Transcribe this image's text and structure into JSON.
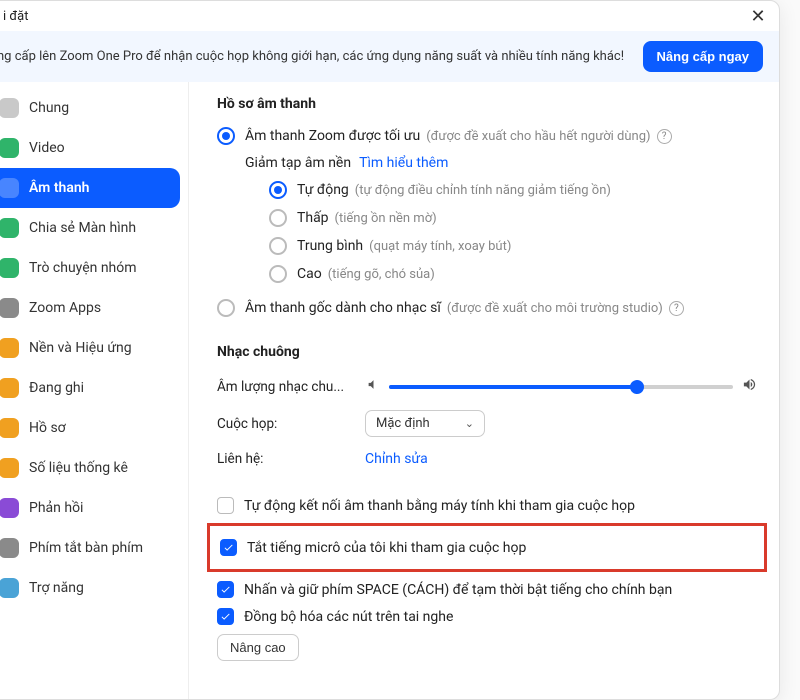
{
  "window": {
    "title": "i đặt",
    "close_glyph": "✕"
  },
  "banner": {
    "text": "ng cấp lên Zoom One Pro để nhận cuộc họp không giới hạn, các ứng dụng năng suất và nhiều tính năng khác!",
    "button": "Nâng cấp ngay"
  },
  "sidebar": {
    "items": [
      {
        "label": "Chung",
        "color": "#c9c9c9",
        "active": false
      },
      {
        "label": "Video",
        "color": "#2fb46a",
        "active": false
      },
      {
        "label": "Âm thanh",
        "color": "#0b5cff",
        "active": true
      },
      {
        "label": "Chia sẻ Màn hình",
        "color": "#2fb46a",
        "active": false
      },
      {
        "label": "Trò chuyện nhóm",
        "color": "#2fb46a",
        "active": false
      },
      {
        "label": "Zoom Apps",
        "color": "#8a8a8a",
        "active": false
      },
      {
        "label": "Nền và Hiệu ứng",
        "color": "#f0a020",
        "active": false
      },
      {
        "label": "Đang ghi",
        "color": "#f0a020",
        "active": false
      },
      {
        "label": "Hồ sơ",
        "color": "#f0a020",
        "active": false
      },
      {
        "label": "Số liệu thống kê",
        "color": "#f0a020",
        "active": false
      },
      {
        "label": "Phản hồi",
        "color": "#8a4bd6",
        "active": false
      },
      {
        "label": "Phím tắt bàn phím",
        "color": "#8a8a8a",
        "active": false
      },
      {
        "label": "Trợ năng",
        "color": "#4aa3d6",
        "active": false
      }
    ]
  },
  "profile": {
    "section_title": "Hồ sơ âm thanh",
    "opt_zoom_label": "Âm thanh Zoom được tối ưu",
    "opt_zoom_hint": "(được đề xuất cho hầu hết người dùng)",
    "noise_label": "Giảm tạp âm nền",
    "noise_link": "Tìm hiểu thêm",
    "noise_opts": [
      {
        "label": "Tự động",
        "hint": "(tự động điều chỉnh tính năng giảm tiếng ồn)",
        "checked": true
      },
      {
        "label": "Thấp",
        "hint": "(tiếng ồn nền mờ)",
        "checked": false
      },
      {
        "label": "Trung bình",
        "hint": "(quạt máy tính, xoay bút)",
        "checked": false
      },
      {
        "label": "Cao",
        "hint": "(tiếng gõ, chó sủa)",
        "checked": false
      }
    ],
    "opt_original_label": "Âm thanh gốc dành cho nhạc sĩ",
    "opt_original_hint": "(được đề xuất cho môi trường studio)"
  },
  "ringtone": {
    "section_title": "Nhạc chuông",
    "volume_label": "Âm lượng nhạc chu...",
    "slider_percent": 72,
    "meeting_label": "Cuộc họp:",
    "meeting_value": "Mặc định",
    "contact_label": "Liên hệ:",
    "contact_value": "Chỉnh sửa"
  },
  "checks": {
    "items": [
      {
        "label": "Tự động kết nối âm thanh bằng máy tính khi tham gia cuộc họp",
        "checked": false,
        "highlight": false
      },
      {
        "label": "Tắt tiếng micrô của tôi khi tham gia cuộc họp",
        "checked": true,
        "highlight": true
      },
      {
        "label": "Nhấn và giữ phím SPACE (CÁCH) để tạm thời bật tiếng cho chính bạn",
        "checked": true,
        "highlight": false
      },
      {
        "label": "Đồng bộ hóa các nút trên tai nghe",
        "checked": true,
        "highlight": false
      }
    ]
  },
  "advanced_label": "Nâng cao"
}
